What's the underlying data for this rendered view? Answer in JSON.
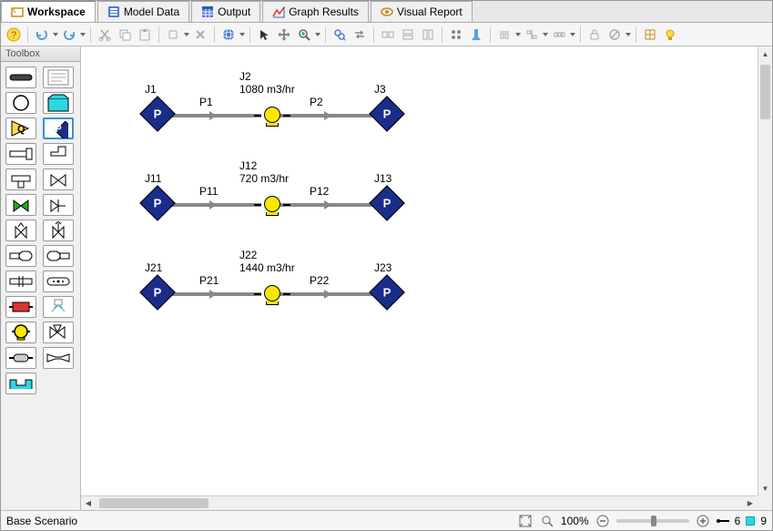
{
  "tabs": [
    {
      "label": "Workspace",
      "icon": "workspace-icon",
      "active": true
    },
    {
      "label": "Model Data",
      "icon": "model-data-icon",
      "active": false
    },
    {
      "label": "Output",
      "icon": "output-icon",
      "active": false
    },
    {
      "label": "Graph Results",
      "icon": "graph-icon",
      "active": false
    },
    {
      "label": "Visual Report",
      "icon": "visual-report-icon",
      "active": false
    }
  ],
  "toolbox_title": "Toolbox",
  "status": {
    "scenario": "Base Scenario",
    "zoom": "100%",
    "pipe_count": "6",
    "junction_count": "9"
  },
  "chart_data": {
    "type": "pipe-network",
    "rows": [
      {
        "left_junction": {
          "id": "J1",
          "type": "assigned-pressure",
          "label": "P"
        },
        "pipe_left": {
          "id": "P1"
        },
        "pump": {
          "id": "J2",
          "flow": "1080 m3/hr"
        },
        "pipe_right": {
          "id": "P2"
        },
        "right_junction": {
          "id": "J3",
          "type": "assigned-pressure",
          "label": "P"
        }
      },
      {
        "left_junction": {
          "id": "J11",
          "type": "assigned-pressure",
          "label": "P"
        },
        "pipe_left": {
          "id": "P11"
        },
        "pump": {
          "id": "J12",
          "flow": "720 m3/hr"
        },
        "pipe_right": {
          "id": "P12"
        },
        "right_junction": {
          "id": "J13",
          "type": "assigned-pressure",
          "label": "P"
        }
      },
      {
        "left_junction": {
          "id": "J21",
          "type": "assigned-pressure",
          "label": "P"
        },
        "pipe_left": {
          "id": "P21"
        },
        "pump": {
          "id": "J22",
          "flow": "1440 m3/hr"
        },
        "pipe_right": {
          "id": "P22"
        },
        "right_junction": {
          "id": "J23",
          "type": "assigned-pressure",
          "label": "P"
        }
      }
    ]
  }
}
